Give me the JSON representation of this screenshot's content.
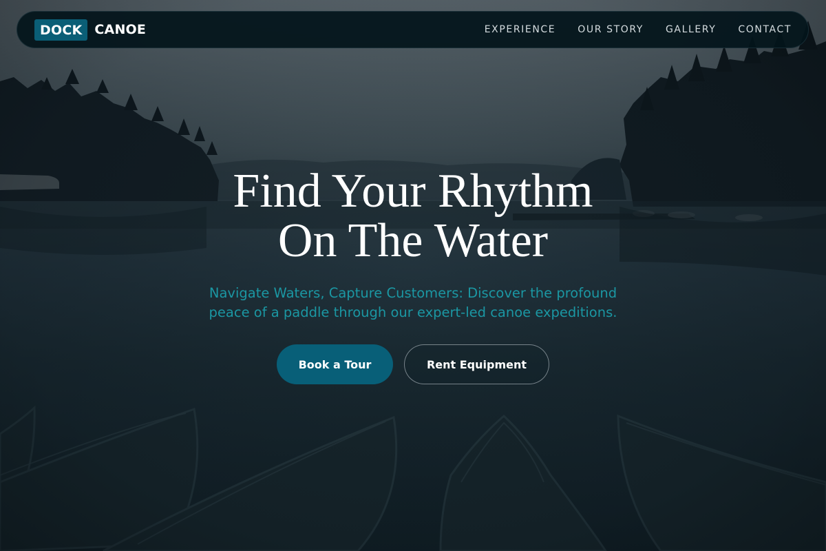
{
  "brand": {
    "badge": "DOCK",
    "name": "CANOE"
  },
  "nav": {
    "links": [
      "EXPERIENCE",
      "OUR STORY",
      "GALLERY",
      "CONTACT"
    ]
  },
  "hero": {
    "title_line1": "Find Your Rhythm",
    "title_line2": "On The Water",
    "subtitle": "Navigate Waters, Capture Customers: Discover the profound peace of a paddle through our expert-led canoe expeditions.",
    "primary_cta": "Book a Tour",
    "secondary_cta": "Rent Equipment"
  },
  "colors": {
    "accent": "#085f78",
    "subtitle": "#1b97a3",
    "navbar_bg": "#03141b"
  },
  "icons": []
}
